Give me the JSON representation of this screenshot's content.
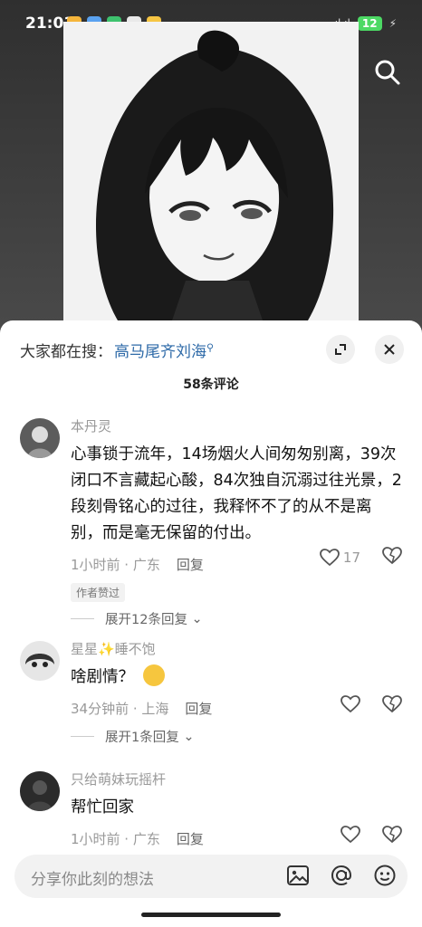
{
  "status_bar": {
    "time": "21:01",
    "battery": "12",
    "signal": "ıl ıl"
  },
  "sheet": {
    "search_hint": "大家都在搜：",
    "search_term": "高马尾齐刘海",
    "comment_count": "58条评论"
  },
  "comments": [
    {
      "author": "本丹灵",
      "text": "心事锁于流年，14场烟火人间匆匆别离，39次闭口不言藏起心酸，84次独自沉溺过往光景，2段刻骨铭心的过往，我释怀不了的从不是离别，而是毫无保留的付出。",
      "time": "1小时前 · 广东",
      "reply": "回复",
      "likes": "17",
      "tag": "作者赞过",
      "expand": "展开12条回复"
    },
    {
      "author": "星星✨睡不饱",
      "text": "啥剧情？",
      "time": "34分钟前 · 上海",
      "reply": "回复",
      "expand": "展开1条回复"
    },
    {
      "author": "只给萌妹玩摇杆",
      "text": "帮忙回家",
      "time": "1小时前 · 广东",
      "reply": "回复"
    }
  ],
  "input": {
    "placeholder": "分享你此刻的想法"
  }
}
